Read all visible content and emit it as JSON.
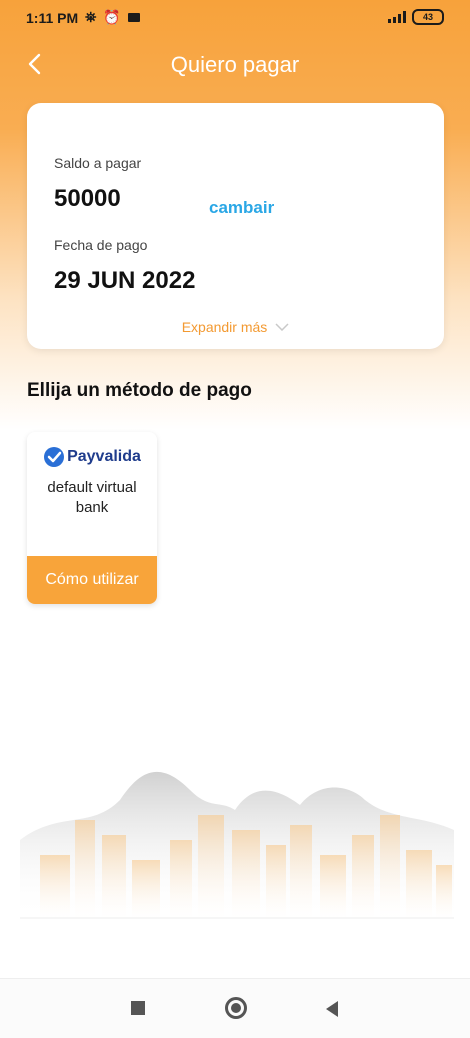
{
  "status_bar": {
    "time": "1:11 PM",
    "battery": "43"
  },
  "header": {
    "back_icon": "chevron-left-icon",
    "title": "Quiero pagar"
  },
  "summary_card": {
    "balance_label": "Saldo a pagar",
    "balance_value": "50000",
    "change_link": "cambair",
    "date_label": "Fecha de pago",
    "date_value": "29 JUN 2022",
    "expand_label": "Expandir más"
  },
  "payment_section": {
    "title": "Ellija un método de pago",
    "methods": [
      {
        "logo_text": "Payvalida",
        "name": "default virtual bank",
        "action_label": "Cómo utilizar"
      }
    ]
  },
  "colors": {
    "accent": "#f8a43a",
    "link": "#2aa7e6",
    "expand": "#f39a32"
  }
}
